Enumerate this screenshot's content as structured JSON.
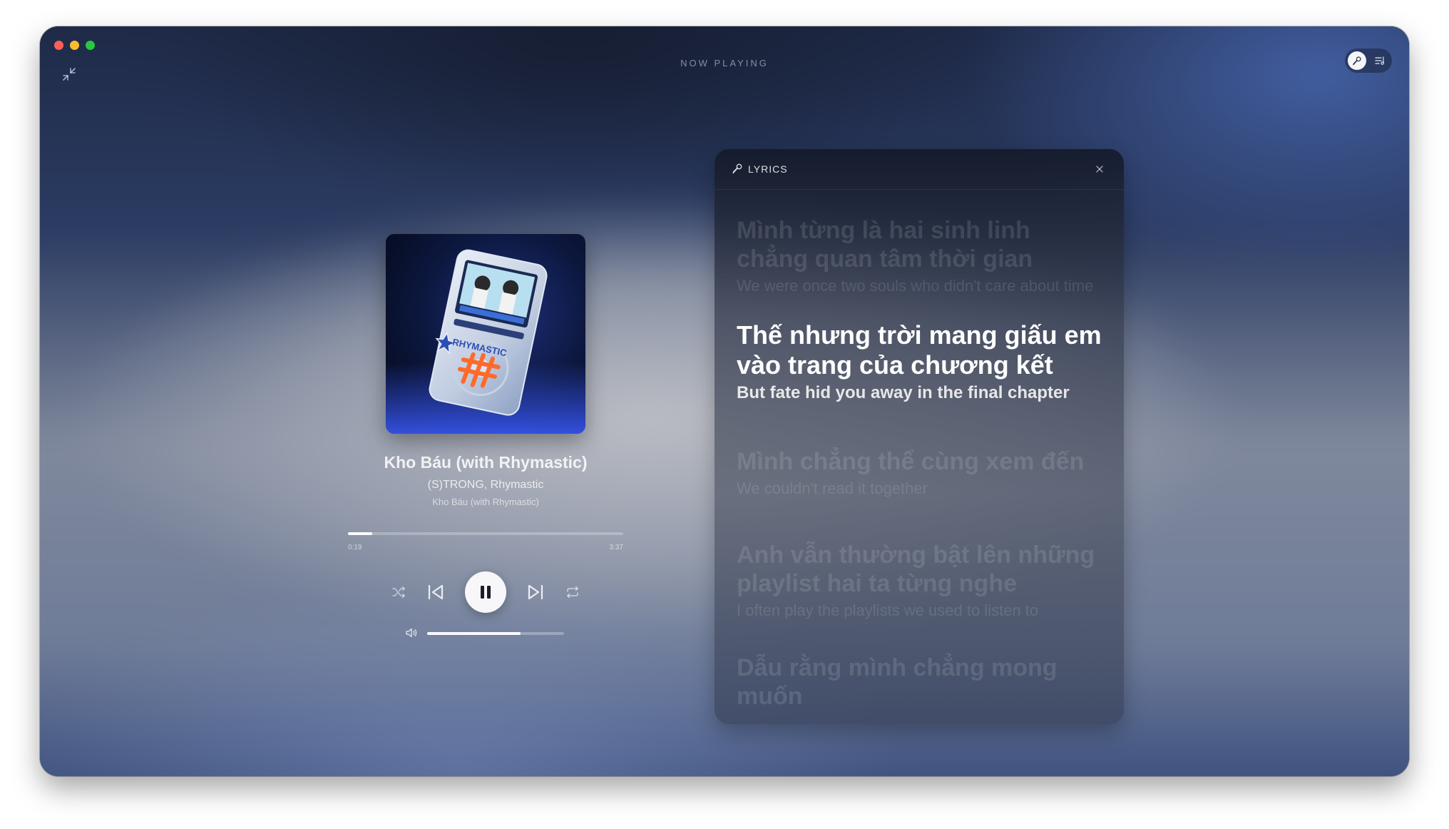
{
  "header": {
    "title": "NOW PLAYING"
  },
  "track": {
    "title": "Kho Báu (with Rhymastic)",
    "artist": "(S)TRONG, Rhymastic",
    "album": "Kho Báu (with Rhymastic)",
    "elapsed": "0:19",
    "duration": "3:37",
    "progress_fraction": 0.088,
    "volume_fraction": 0.68,
    "album_art_text": "RHYMASTIC"
  },
  "lyrics": {
    "label": "LYRICS",
    "lines": [
      {
        "main": "Mình từng là hai sinh linh chẳng quan tâm thời gian",
        "trans": "We were once two souls who didn't care about time"
      },
      {
        "main": "Thế nhưng trời mang giấu em vào trang của chương kết",
        "trans": "But fate hid you away in the final chapter"
      },
      {
        "main": "Mình chẳng thể cùng xem đến",
        "trans": "We couldn't read it together"
      },
      {
        "main": "Anh vẫn thường bật lên những playlist hai ta từng nghe",
        "trans": "I often play the playlists we used to listen to"
      },
      {
        "main": "Dẫu rằng mình chẳng mong muốn",
        "trans": ""
      }
    ]
  },
  "colors": {
    "accent_red": "#ff5f57",
    "accent_yellow": "#febc2e",
    "accent_green": "#28c840"
  },
  "icons": {
    "minimize": "arrows-in-icon",
    "lyrics": "microphone-icon",
    "queue": "list-music-icon",
    "close": "close-icon",
    "shuffle": "shuffle-icon",
    "previous": "skip-back-icon",
    "play_pause": "pause-icon",
    "next": "skip-forward-icon",
    "repeat": "repeat-icon",
    "volume": "speaker-icon"
  }
}
